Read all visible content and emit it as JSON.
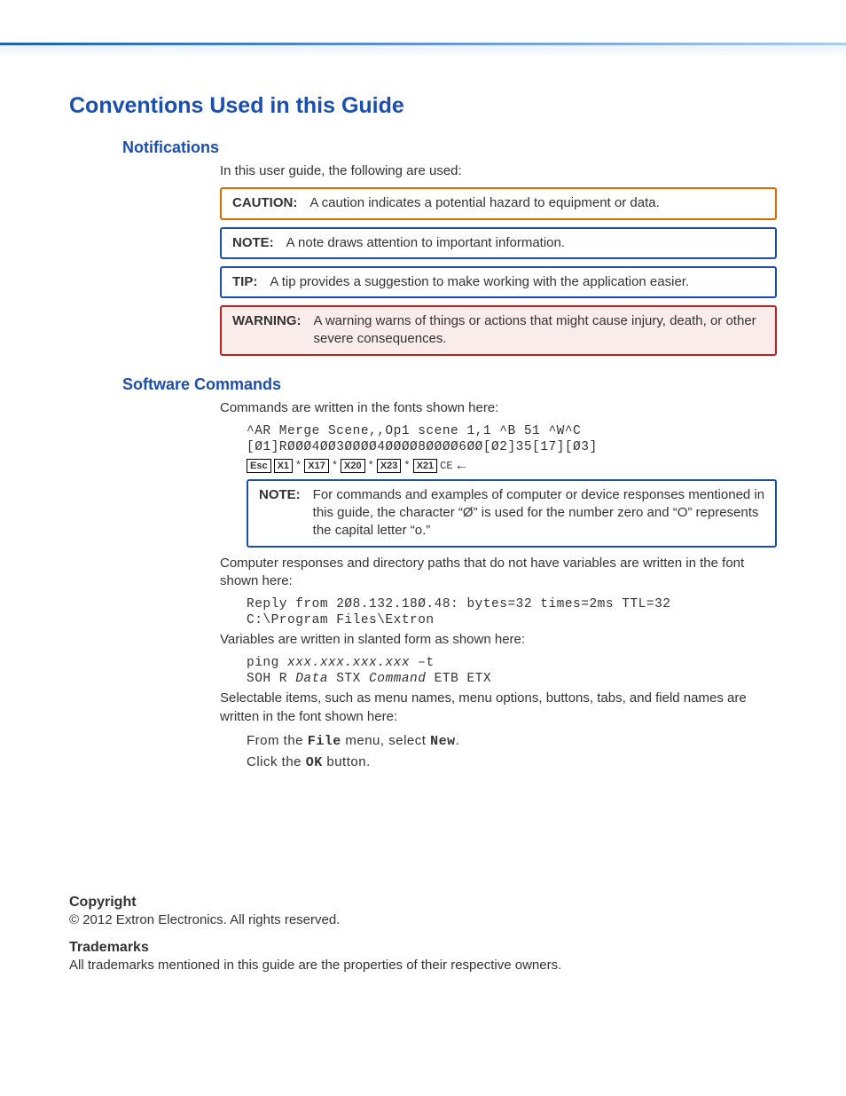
{
  "title": "Conventions Used in this Guide",
  "notifications": {
    "heading": "Notifications",
    "intro": "In this user guide, the following are used:",
    "caution_label": "CAUTION:",
    "caution_text": "A caution indicates a potential hazard to equipment or data.",
    "note_label": "NOTE:",
    "note_text": "A note draws attention to important information.",
    "tip_label": "TIP:",
    "tip_text": "A tip provides a suggestion to make working with the application easier.",
    "warning_label": "WARNING:",
    "warning_text": "A warning warns of things or actions that might cause injury, death, or other severe consequences."
  },
  "software": {
    "heading": "Software Commands",
    "intro": "Commands are written in the fonts shown here:",
    "line1": "^AR Merge Scene,,Op1 scene 1,1 ^B 51 ^W^C",
    "line2": "[Ø1]RØØØ4ØØ3ØØØØ4ØØØØ8ØØØØ6ØØ[Ø2]35[17][Ø3]",
    "keys": {
      "esc": "Esc",
      "x1": "X1",
      "x17": "X17",
      "x20": "X20",
      "x23": "X23",
      "x21": "X21",
      "star": "*",
      "ce": "CE"
    },
    "note_label": "NOTE:",
    "note_text": "For commands and examples of computer or device responses mentioned in this guide, the character “Ø” is used for the number zero and “O” represents the capital letter “o.”",
    "resp_intro": "Computer responses and directory paths that do not have variables are written in the font shown here:",
    "resp_line1": "Reply from 2Ø8.132.18Ø.48: bytes=32 times=2ms TTL=32",
    "resp_line2": "C:\\Program Files\\Extron",
    "var_intro": "Variables are written in slanted form as shown here:",
    "var_line1_a": "ping ",
    "var_line1_b": "xxx.xxx.xxx.xxx",
    "var_line1_c": " –t",
    "var_line2_a": "SOH R ",
    "var_line2_b": "Data",
    "var_line2_c": " STX ",
    "var_line2_d": "Command",
    "var_line2_e": " ETB ETX",
    "sel_intro": "Selectable items, such as menu names, menu options, buttons, tabs, and field names are written in the font shown here:",
    "sel_line1_a": "From the ",
    "sel_line1_b": "File",
    "sel_line1_c": " menu, select ",
    "sel_line1_d": "New",
    "sel_line1_e": ".",
    "sel_line2_a": "Click the ",
    "sel_line2_b": "OK",
    "sel_line2_c": " button."
  },
  "footer": {
    "copyright_h": "Copyright",
    "copyright_p": "© 2012  Extron Electronics. All rights reserved.",
    "trademarks_h": "Trademarks",
    "trademarks_p": "All trademarks mentioned in this guide are the properties of their respective owners."
  }
}
